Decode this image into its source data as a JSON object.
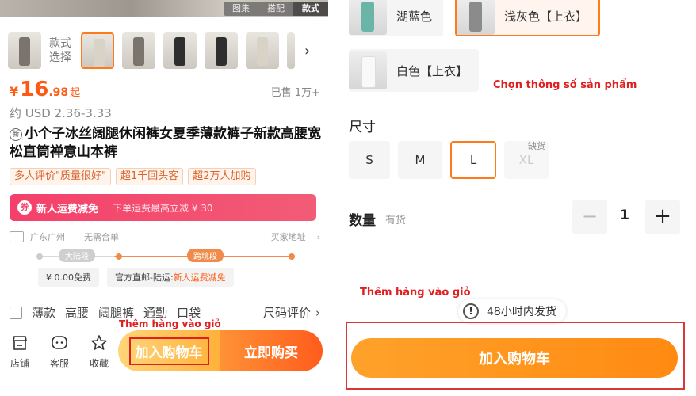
{
  "left": {
    "hero_tabs": [
      "图集",
      "搭配",
      "款式"
    ],
    "style_label": "款式\n选择",
    "price": {
      "currency": "¥",
      "integer": "16",
      "decimal": ".98",
      "unit": "起"
    },
    "sold": "已售 1万+",
    "usd": "约 USD 2.36-3.33",
    "new_badge": "新",
    "title": "小个子冰丝阔腿休闲裤女夏季薄款裤子新款高腰宽松直筒禅意山本裤",
    "tags": [
      "多人评价\"质量很好\"",
      "超1千回头客",
      "超2万人加购"
    ],
    "promo": {
      "icon": "券",
      "title": "新人运费减免",
      "sub": "下单运费最高立减 ¥ 30"
    },
    "shipping": {
      "from": "广东广州",
      "merge": "无需合单",
      "address": "买家地址",
      "stage1": "大陆段",
      "stage2": "跨境段",
      "box1": "¥ 0.00免费",
      "box2_prefix": "官方直邮-陆运:",
      "box2_highlight": "新人运费减免"
    },
    "chips": [
      "薄款",
      "高腰",
      "阔腿裤",
      "通勤",
      "口袋"
    ],
    "size_review": "尺码评价",
    "nav": [
      "店铺",
      "客服",
      "收藏"
    ],
    "add_to_cart": "加入购物车",
    "buy_now": "立即购买",
    "annotation": "Thêm hàng vào giỏ"
  },
  "right": {
    "colors": [
      {
        "label": "湖蓝色"
      },
      {
        "label": "浅灰色【上衣】",
        "selected": true
      },
      {
        "label": "白色【上衣】"
      }
    ],
    "annotation_spec": "Chọn thông số sản phẩm",
    "size_label": "尺寸",
    "sizes": [
      "S",
      "M",
      "L",
      "XL"
    ],
    "selected_size": "L",
    "out_of_stock": "缺货",
    "qty_label": "数量",
    "qty_stock": "有货",
    "qty_minus": "−",
    "qty_value": "1",
    "qty_plus": "+",
    "annotation_cart": "Thêm hàng vào giỏ",
    "delivery_icon": "!",
    "delivery": "48小时内发货",
    "add_to_cart": "加入购物车"
  },
  "colors": {
    "accent": "#ff7a1a",
    "price": "#ff5a14",
    "annotation": "#e02020",
    "promo": "#f4406a"
  }
}
